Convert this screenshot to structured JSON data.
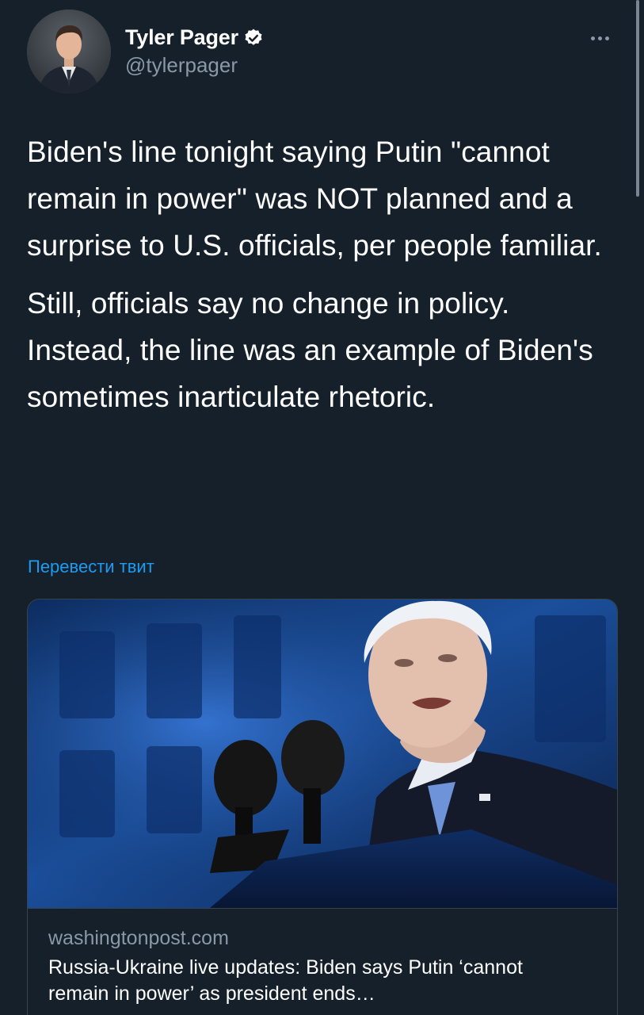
{
  "author": {
    "display_name": "Tyler Pager",
    "handle": "@tylerpager",
    "verified": true
  },
  "icons": {
    "verified": "verified-badge-icon",
    "more": "more-options-icon"
  },
  "tweet": {
    "paragraphs": [
      "Biden's line tonight saying Putin \"cannot remain in power\" was NOT planned and a surprise to U.S. officials, per people familiar.",
      "Still, officials say no change in policy. Instead, the line was an example of Biden's sometimes inarticulate rhetoric."
    ],
    "translate_label": "Перевести твит"
  },
  "link_card": {
    "domain": "washingtonpost.com",
    "title": "Russia-Ukraine live updates: Biden says Putin ‘cannot remain in power’ as president ends…"
  },
  "colors": {
    "background": "#15202b",
    "text_primary": "#ffffff",
    "text_secondary": "#8b98a5",
    "accent": "#1d9bf0",
    "border": "#38444d"
  }
}
